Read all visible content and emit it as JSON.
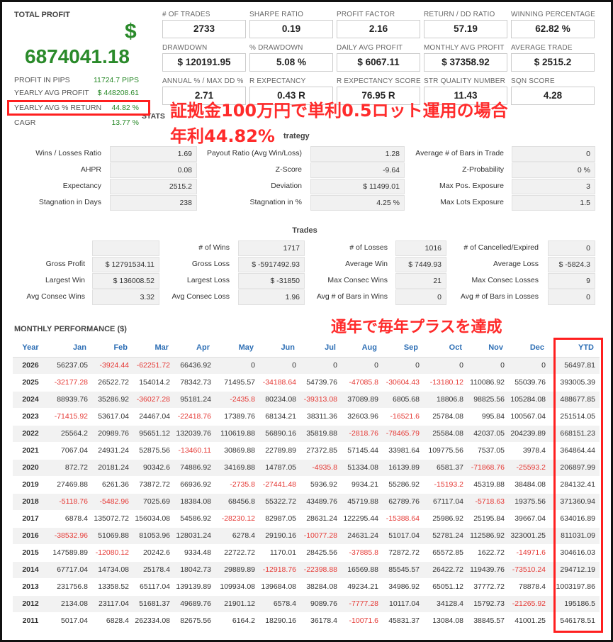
{
  "summary": {
    "total_profit_label": "TOTAL PROFIT",
    "currency_symbol": "$",
    "total_profit_value": "6874041.18",
    "side_rows": [
      {
        "label": "PROFIT IN PIPS",
        "value": "11724.7 PIPS"
      },
      {
        "label": "YEARLY AVG PROFIT",
        "value": "$ 448208.61"
      },
      {
        "label": "YEARLY AVG % RETURN",
        "value": "44.82 %"
      },
      {
        "label": "CAGR",
        "value": "13.77 %"
      }
    ]
  },
  "kpis": [
    {
      "label": "# OF TRADES",
      "value": "2733"
    },
    {
      "label": "SHARPE RATIO",
      "value": "0.19"
    },
    {
      "label": "PROFIT FACTOR",
      "value": "2.16"
    },
    {
      "label": "RETURN / DD RATIO",
      "value": "57.19"
    },
    {
      "label": "WINNING PERCENTAGE",
      "value": "62.82 %"
    },
    {
      "label": "DRAWDOWN",
      "value": "$ 120191.95"
    },
    {
      "label": "% DRAWDOWN",
      "value": "5.08 %"
    },
    {
      "label": "DAILY AVG PROFIT",
      "value": "$ 6067.11"
    },
    {
      "label": "MONTHLY AVG PROFIT",
      "value": "$ 37358.92"
    },
    {
      "label": "AVERAGE TRADE",
      "value": "$ 2515.2"
    },
    {
      "label": "ANNUAL % / MAX DD %",
      "value": "2.71"
    },
    {
      "label": "R EXPECTANCY",
      "value": "0.43 R"
    },
    {
      "label": "R EXPECTANCY SCORE",
      "value": "76.95 R"
    },
    {
      "label": "STR QUALITY NUMBER",
      "value": "11.43"
    },
    {
      "label": "SQN SCORE",
      "value": "4.28"
    }
  ],
  "stats_title_partial": "STATS",
  "strategy_title_partial": "trategy",
  "strategy_rows": [
    [
      {
        "label": "Wins / Losses Ratio",
        "value": "1.69"
      },
      {
        "label": "Payout Ratio (Avg Win/Loss)",
        "value": "1.28"
      },
      {
        "label": "Average # of Bars in Trade",
        "value": "0"
      }
    ],
    [
      {
        "label": "AHPR",
        "value": "0.08"
      },
      {
        "label": "Z-Score",
        "value": "-9.64"
      },
      {
        "label": "Z-Probability",
        "value": "0 %"
      }
    ],
    [
      {
        "label": "Expectancy",
        "value": "2515.2"
      },
      {
        "label": "Deviation",
        "value": "$ 11499.01"
      },
      {
        "label": "Max Pos. Exposure",
        "value": "3"
      }
    ],
    [
      {
        "label": "Stagnation in Days",
        "value": "238"
      },
      {
        "label": "Stagnation in %",
        "value": "4.25 %"
      },
      {
        "label": "Max Lots Exposure",
        "value": "1.5"
      }
    ]
  ],
  "trades_title": "Trades",
  "trades_rows": [
    [
      {
        "label": "",
        "value": ""
      },
      {
        "label": "# of Wins",
        "value": "1717"
      },
      {
        "label": "# of Losses",
        "value": "1016"
      },
      {
        "label": "# of Cancelled/Expired",
        "value": "0"
      }
    ],
    [
      {
        "label": "Gross Profit",
        "value": "$ 12791534.11"
      },
      {
        "label": "Gross Loss",
        "value": "$ -5917492.93"
      },
      {
        "label": "Average Win",
        "value": "$ 7449.93"
      },
      {
        "label": "Average Loss",
        "value": "$ -5824.3"
      }
    ],
    [
      {
        "label": "Largest Win",
        "value": "$ 136008.52"
      },
      {
        "label": "Largest Loss",
        "value": "$ -31850"
      },
      {
        "label": "Max Consec Wins",
        "value": "21"
      },
      {
        "label": "Max Consec Losses",
        "value": "9"
      }
    ],
    [
      {
        "label": "Avg Consec Wins",
        "value": "3.32"
      },
      {
        "label": "Avg Consec Loss",
        "value": "1.96"
      },
      {
        "label": "Avg # of Bars in Wins",
        "value": "0"
      },
      {
        "label": "Avg # of Bars in Losses",
        "value": "0"
      }
    ]
  ],
  "monthly": {
    "title": "MONTHLY PERFORMANCE ($)",
    "headers": [
      "Year",
      "Jan",
      "Feb",
      "Mar",
      "Apr",
      "May",
      "Jun",
      "Jul",
      "Aug",
      "Sep",
      "Oct",
      "Nov",
      "Dec",
      "YTD"
    ],
    "rows": [
      [
        "2026",
        "56237.05",
        "-3924.44",
        "-62251.72",
        "66436.92",
        "0",
        "0",
        "0",
        "0",
        "0",
        "0",
        "0",
        "0",
        "56497.81"
      ],
      [
        "2025",
        "-32177.28",
        "26522.72",
        "154014.2",
        "78342.73",
        "71495.57",
        "-34188.64",
        "54739.76",
        "-47085.8",
        "-30604.43",
        "-13180.12",
        "110086.92",
        "55039.76",
        "393005.39"
      ],
      [
        "2024",
        "88939.76",
        "35286.92",
        "-36027.28",
        "95181.24",
        "-2435.8",
        "80234.08",
        "-39313.08",
        "37089.89",
        "6805.68",
        "18806.8",
        "98825.56",
        "105284.08",
        "488677.85"
      ],
      [
        "2023",
        "-71415.92",
        "53617.04",
        "24467.04",
        "-22418.76",
        "17389.76",
        "68134.21",
        "38311.36",
        "32603.96",
        "-16521.6",
        "25784.08",
        "995.84",
        "100567.04",
        "251514.05"
      ],
      [
        "2022",
        "25564.2",
        "20989.76",
        "95651.12",
        "132039.76",
        "110619.88",
        "56890.16",
        "35819.88",
        "-2818.76",
        "-78465.79",
        "25584.08",
        "42037.05",
        "204239.89",
        "668151.23"
      ],
      [
        "2021",
        "7067.04",
        "24931.24",
        "52875.56",
        "-13460.11",
        "30869.88",
        "22789.89",
        "27372.85",
        "57145.44",
        "33981.64",
        "109775.56",
        "7537.05",
        "3978.4",
        "364864.44"
      ],
      [
        "2020",
        "872.72",
        "20181.24",
        "90342.6",
        "74886.92",
        "34169.88",
        "14787.05",
        "-4935.8",
        "51334.08",
        "16139.89",
        "6581.37",
        "-71868.76",
        "-25593.2",
        "206897.99"
      ],
      [
        "2019",
        "27469.88",
        "6261.36",
        "73872.72",
        "66936.92",
        "-2735.8",
        "-27441.48",
        "5936.92",
        "9934.21",
        "55286.92",
        "-15193.2",
        "45319.88",
        "38484.08",
        "284132.41"
      ],
      [
        "2018",
        "-5118.76",
        "-5482.96",
        "7025.69",
        "18384.08",
        "68456.8",
        "55322.72",
        "43489.76",
        "45719.88",
        "62789.76",
        "67117.04",
        "-5718.63",
        "19375.56",
        "371360.94"
      ],
      [
        "2017",
        "6878.4",
        "135072.72",
        "156034.08",
        "54586.92",
        "-28230.12",
        "82987.05",
        "28631.24",
        "122295.44",
        "-15388.64",
        "25986.92",
        "25195.84",
        "39667.04",
        "634016.89"
      ],
      [
        "2016",
        "-38532.96",
        "51069.88",
        "81053.96",
        "128031.24",
        "6278.4",
        "29190.16",
        "-10077.28",
        "24631.24",
        "51017.04",
        "52781.24",
        "112586.92",
        "323001.25",
        "811031.09"
      ],
      [
        "2015",
        "147589.89",
        "-12080.12",
        "20242.6",
        "9334.48",
        "22722.72",
        "1170.01",
        "28425.56",
        "-37885.8",
        "72872.72",
        "65572.85",
        "1622.72",
        "-14971.6",
        "304616.03"
      ],
      [
        "2014",
        "67717.04",
        "14734.08",
        "25178.4",
        "18042.73",
        "29889.89",
        "-12918.76",
        "-22398.88",
        "16569.88",
        "85545.57",
        "26422.72",
        "119439.76",
        "-73510.24",
        "294712.19"
      ],
      [
        "2013",
        "231756.8",
        "13358.52",
        "65117.04",
        "139139.89",
        "109934.08",
        "139684.08",
        "38284.08",
        "49234.21",
        "34986.92",
        "65051.12",
        "37772.72",
        "78878.4",
        "1003197.86"
      ],
      [
        "2012",
        "2134.08",
        "23117.04",
        "51681.37",
        "49689.76",
        "21901.12",
        "6578.4",
        "9089.76",
        "-7777.28",
        "10117.04",
        "34128.4",
        "15792.73",
        "-21265.92",
        "195186.5"
      ],
      [
        "2011",
        "5017.04",
        "6828.4",
        "262334.08",
        "82675.56",
        "6164.2",
        "18290.16",
        "36178.4",
        "-10071.6",
        "45831.37",
        "13084.08",
        "38845.57",
        "41001.25",
        "546178.51"
      ]
    ]
  },
  "annotations": {
    "line1": "証拠金100万円で単利0.5ロット運用の場合",
    "line2": "年利44.82%",
    "line3": "通年で毎年プラスを達成"
  },
  "colors": {
    "profit_green": "#2a8a2a",
    "negative_red": "#e53935",
    "header_blue": "#2e6fb5",
    "annotation_red": "#ff2b2b"
  }
}
